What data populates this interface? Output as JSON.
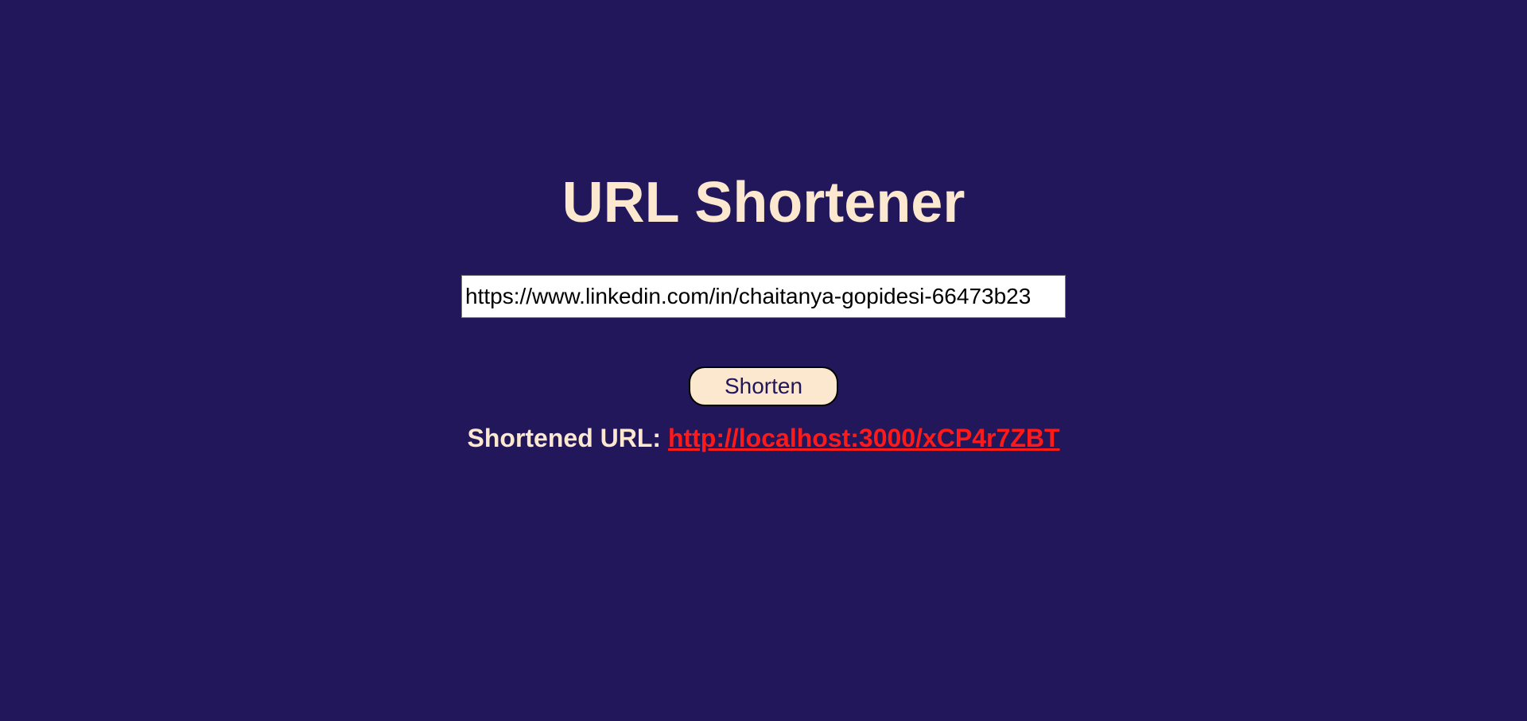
{
  "app": {
    "title": "URL Shortener"
  },
  "form": {
    "url_value": "https://www.linkedin.com/in/chaitanya-gopidesi-66473b23",
    "shorten_label": "Shorten"
  },
  "result": {
    "label": "Shortened URL:",
    "short_url": "http://localhost:3000/xCP4r7ZBT"
  },
  "colors": {
    "background": "#21175a",
    "accent_text": "#fbe8cf",
    "link": "#ff1a1a",
    "button_bg": "#fbe8cf"
  }
}
